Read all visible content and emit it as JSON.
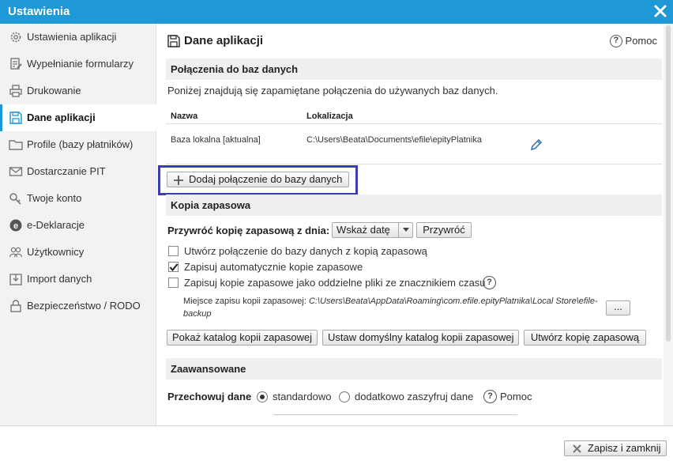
{
  "window": {
    "title": "Ustawienia"
  },
  "sidebar": {
    "items": [
      {
        "label": "Ustawienia aplikacji",
        "icon": "gear-icon"
      },
      {
        "label": "Wypełnianie formularzy",
        "icon": "form-fill-icon"
      },
      {
        "label": "Drukowanie",
        "icon": "printer-icon"
      },
      {
        "label": "Dane aplikacji",
        "icon": "floppy-icon",
        "active": true
      },
      {
        "label": "Profile (bazy płatników)",
        "icon": "folder-icon"
      },
      {
        "label": "Dostarczanie PIT",
        "icon": "envelope-icon"
      },
      {
        "label": "Twoje konto",
        "icon": "key-icon"
      },
      {
        "label": "e-Deklaracje",
        "icon": "e-declaration-icon"
      },
      {
        "label": "Użytkownicy",
        "icon": "users-icon"
      },
      {
        "label": "Import danych",
        "icon": "import-icon"
      },
      {
        "label": "Bezpieczeństwo / RODO",
        "icon": "lock-icon"
      }
    ]
  },
  "main": {
    "title": "Dane aplikacji",
    "help_label": "Pomoc",
    "connections": {
      "heading": "Połączenia do baz danych",
      "description": "Poniżej znajdują się zapamiętane połączenia do używanych baz danych.",
      "columns": [
        "Nazwa",
        "Lokalizacja"
      ],
      "rows": [
        {
          "name": "Baza lokalna [aktualna]",
          "location": "C:\\Users\\Beata\\Documents\\efile\\epityPlatnika"
        }
      ],
      "add_button": "Dodaj połączenie do bazy danych"
    },
    "backup": {
      "heading": "Kopia zapasowa",
      "restore_label": "Przywróć kopię zapasową z dnia:",
      "date_select": "Wskaż datę",
      "restore_button": "Przywróć",
      "options": [
        {
          "label": "Utwórz połączenie do bazy danych z kopią zapasową",
          "checked": false
        },
        {
          "label": "Zapisuj automatycznie kopie zapasowe",
          "checked": true
        },
        {
          "label": "Zapisuj kopie zapasowe jako oddzielne pliki ze znacznikiem czasu",
          "checked": false
        }
      ],
      "location_label": "Miejsce zapisu kopii zapasowej:",
      "location_line1": "C:\\Users\\Beata\\AppData\\Roaming\\com.efile.epityPlatnika\\Local Store\\efile-",
      "location_line2": "backup",
      "browse_button": "...",
      "buttons": [
        "Pokaż katalog kopii zapasowej",
        "Ustaw domyślny katalog kopii zapasowej",
        "Utwórz kopię zapasową"
      ]
    },
    "advanced": {
      "heading": "Zaawansowane",
      "store_label": "Przechowuj dane",
      "option_standard": "standardowo",
      "option_encrypt": "dodatkowo zaszyfruj dane",
      "selected": "standardowo",
      "help_label": "Pomoc"
    }
  },
  "footer": {
    "save_close": "Zapisz i zamknij"
  },
  "colors": {
    "accent": "#1e98d6",
    "focus_outline": "#3b3ea9",
    "edit_icon": "#2a6db5"
  }
}
